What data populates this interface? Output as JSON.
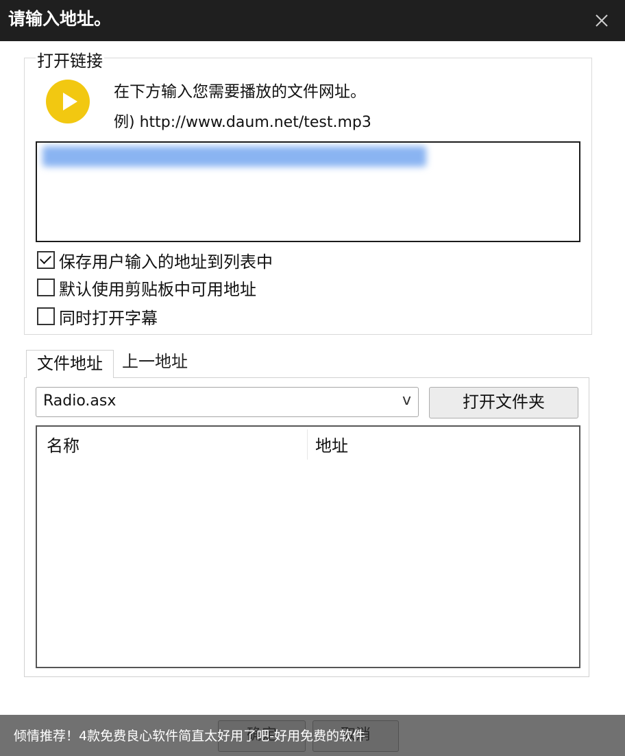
{
  "window": {
    "title": "请输入地址。",
    "close_icon": "close-icon"
  },
  "open_link": {
    "legend": "打开链接",
    "icon": "play-icon",
    "icon_color": "#f2c811",
    "instruction": "在下方输入您需要播放的文件网址。",
    "example": "例) http://www.daum.net/test.mp3",
    "url_value": ""
  },
  "options": [
    {
      "label": "保存用户输入的地址到列表中",
      "checked": true
    },
    {
      "label": "默认使用剪贴板中可用地址",
      "checked": false
    },
    {
      "label": "同时打开字幕",
      "checked": false
    }
  ],
  "tabs": [
    {
      "label": "文件地址",
      "active": true
    },
    {
      "label": "上一地址",
      "active": false
    }
  ],
  "file_select": {
    "value": "Radio.asx",
    "arrow": "v"
  },
  "open_folder_label": "打开文件夹",
  "table": {
    "columns": [
      "名称",
      "地址"
    ],
    "rows": []
  },
  "buttons": {
    "ok": "确定",
    "cancel": "取消"
  },
  "watermark": "倾情推荐！4款免费良心软件简直太好用了吧-好用免费的软件"
}
